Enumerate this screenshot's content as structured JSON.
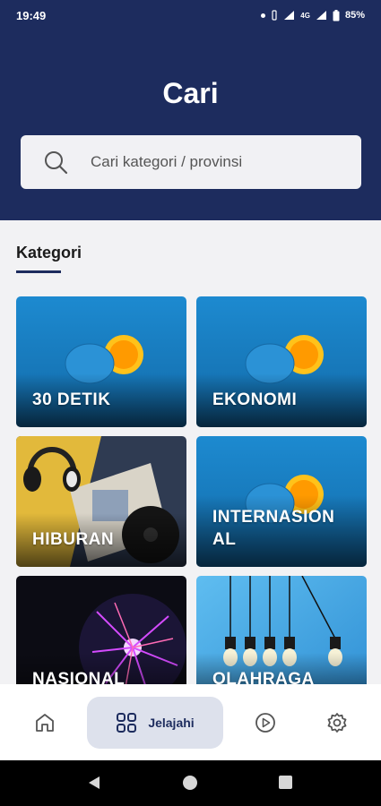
{
  "status_bar": {
    "time": "19:49",
    "network": "4G",
    "battery": "85%"
  },
  "header": {
    "title": "Cari"
  },
  "search": {
    "placeholder": "Cari kategori / provinsi"
  },
  "section": {
    "title": "Kategori"
  },
  "categories": [
    {
      "label": "30 DETIK",
      "image": "orange-blue"
    },
    {
      "label": "EKONOMI",
      "image": "orange-blue"
    },
    {
      "label": "HIBURAN",
      "image": "headphones-vinyl"
    },
    {
      "label": "INTERNASIONAL",
      "image": "orange-blue"
    },
    {
      "label": "NASIONAL",
      "image": "plasma-ball"
    },
    {
      "label": "OLAHRAGA",
      "image": "light-bulbs"
    }
  ],
  "bottom_nav": {
    "items": [
      {
        "name": "home",
        "icon": "home-icon",
        "label": ""
      },
      {
        "name": "jelajahi",
        "icon": "grid-icon",
        "label": "Jelajahi",
        "active": true
      },
      {
        "name": "video",
        "icon": "play-icon",
        "label": ""
      },
      {
        "name": "settings",
        "icon": "gear-icon",
        "label": ""
      }
    ]
  },
  "colors": {
    "primary": "#1d2c5e",
    "background": "#f2f2f4",
    "card_blue": "#1a7fc4"
  }
}
